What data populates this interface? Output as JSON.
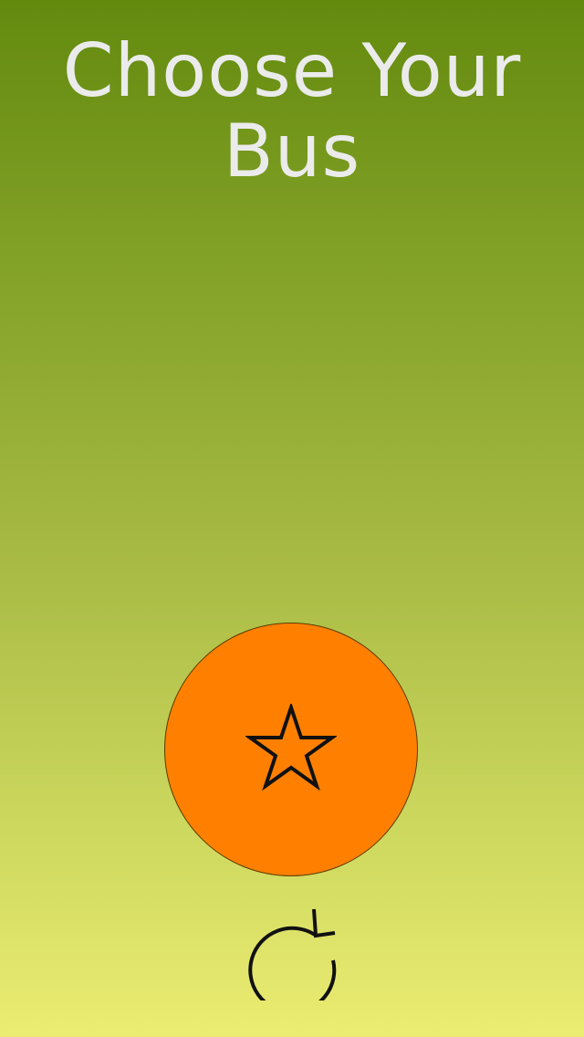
{
  "header": {
    "title_line1": "Choose Your",
    "title_line2": "Bus"
  },
  "favorite_button": {
    "icon": "star-icon",
    "color": "#ff8000"
  },
  "refresh_button": {
    "icon": "refresh-icon"
  },
  "colors": {
    "background_top": "#638a0e",
    "background_bottom": "#ecec72",
    "title_text": "#ebebeb",
    "accent": "#ff8000"
  }
}
